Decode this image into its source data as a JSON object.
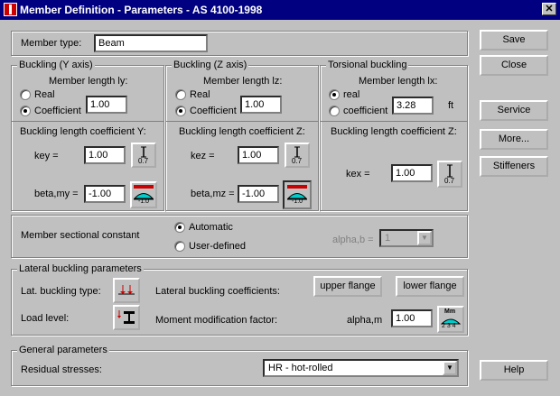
{
  "window": {
    "title": "Member Definition - Parameters - AS 4100-1998",
    "close": "✕"
  },
  "member_type": {
    "label": "Member type:",
    "value": "Beam"
  },
  "buckling_y": {
    "title": "Buckling (Y axis)",
    "length_label": "Member length ly:",
    "real_label": "Real",
    "coefficient_label": "Coefficient",
    "selected": "coefficient",
    "value": "1.00",
    "coef_title": "Buckling length coefficient Y:",
    "key_label": "key =",
    "key_value": "1.00",
    "key_icon_text": "0.7",
    "beta_label": "beta,my =",
    "beta_value": "-1.00",
    "beta_icon_text": "-1.0"
  },
  "buckling_z": {
    "title": "Buckling (Z axis)",
    "length_label": "Member length lz:",
    "real_label": "Real",
    "coefficient_label": "Coefficient",
    "selected": "coefficient",
    "value": "1.00",
    "coef_title": "Buckling length coefficient Z:",
    "key_label": "kez =",
    "key_value": "1.00",
    "key_icon_text": "0.7",
    "beta_label": "beta,mz =",
    "beta_value": "-1.00",
    "beta_icon_text": "-1.0"
  },
  "torsional": {
    "title": "Torsional buckling",
    "length_label": "Member length lx:",
    "real_label": "real",
    "coefficient_label": "coefficient",
    "selected": "real",
    "value": "3.28",
    "unit": "ft",
    "coef_title": "Buckling length coefficient Z:",
    "key_label": "kex =",
    "key_value": "1.00",
    "key_icon_text": "0.7"
  },
  "sectional": {
    "label": "Member sectional constant",
    "automatic": "Automatic",
    "user_defined": "User-defined",
    "selected": "automatic",
    "alpha_label": "alpha,b =",
    "alpha_value": "1"
  },
  "lateral": {
    "title": "Lateral buckling parameters",
    "type_label": "Lat. buckling type:",
    "coefficients_label": "Lateral buckling coefficients:",
    "upper_flange": "upper flange",
    "lower_flange": "lower flange",
    "load_level_label": "Load level:",
    "moment_label": "Moment modification factor:",
    "alpha_m_label": "alpha,m",
    "alpha_m_value": "1.00",
    "mm_icon_top": "Mm",
    "mm_icon_bottom": "2 3 4"
  },
  "general": {
    "title": "General parameters",
    "residual_label": "Residual stresses:",
    "residual_value": "HR - hot-rolled"
  },
  "buttons": {
    "save": "Save",
    "close": "Close",
    "service": "Service",
    "more": "More...",
    "stiffeners": "Stiffeners",
    "help": "Help"
  }
}
